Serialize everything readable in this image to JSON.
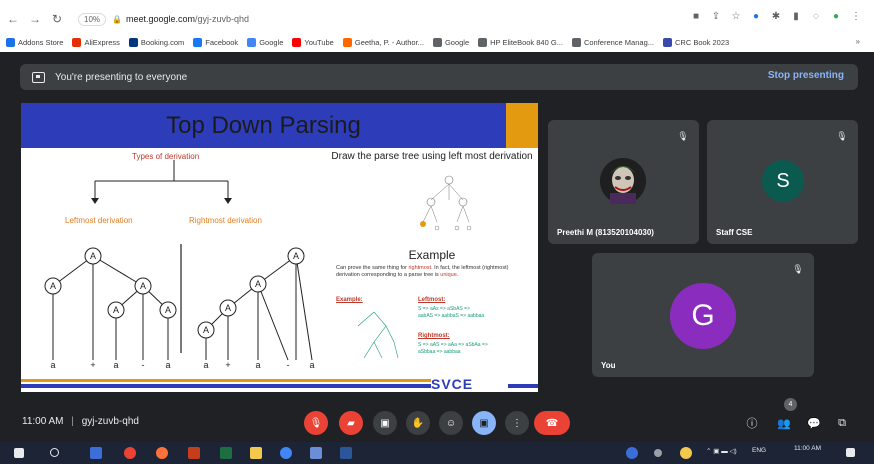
{
  "browser": {
    "zoom": "10%",
    "url_host": "meet.google.com",
    "url_path": "/gyj-zuvb-qhd",
    "bookmarks": [
      {
        "label": "Addons Store",
        "color": "#1a73e8"
      },
      {
        "label": "AliExpress",
        "color": "#e62e04"
      },
      {
        "label": "Booking.com",
        "color": "#003580"
      },
      {
        "label": "Facebook",
        "color": "#1877f2"
      },
      {
        "label": "Google",
        "color": "#4285f4"
      },
      {
        "label": "YouTube",
        "color": "#ff0000"
      },
      {
        "label": "Geetha, P. - Author...",
        "color": "#ff6600"
      },
      {
        "label": "Google",
        "color": "#5f6368"
      },
      {
        "label": "HP EliteBook 840 G...",
        "color": "#5f6368"
      },
      {
        "label": "Conference Manag...",
        "color": "#5f6368"
      },
      {
        "label": "CRC Book 2023",
        "color": "#3949ab"
      }
    ]
  },
  "banner": {
    "text": "You're presenting to everyone",
    "stop_label": "Stop presenting"
  },
  "slide": {
    "title": "Top Down Parsing",
    "types_label": "Types of derivation",
    "leftmost_label": "Leftmost derivation",
    "rightmost_label": "Rightmost derivation",
    "left_leaves": [
      "a",
      "+",
      "a",
      "-",
      "a"
    ],
    "right_leaves": [
      "a",
      "+",
      "a",
      "-",
      "a"
    ],
    "heading": "Draw the parse tree using left most derivation",
    "example_title": "Example",
    "example_text_pre": "Can prove the same thing for ",
    "example_text_red1": "rightmost",
    "example_text_mid": ". In fact, the leftmost (rightmost) derivation corresponding to a parse tree is ",
    "example_text_red2": "unique",
    "example_text_end": ".",
    "example_label": "Example:",
    "leftmost_small": "Leftmost:",
    "leftmost_line1": "S => aAs => aSbAS =>",
    "leftmost_line2": "aabAS => aabbaS => aabbaa",
    "rightmost_small": "Rightmost:",
    "rightmost_line1": "S => aAS => aAa => aSbAa =>",
    "rightmost_line2": "aSbbaa => aabbaa",
    "footer_logo": "SVCE"
  },
  "participants": [
    {
      "name": "Preethi M (813520104030)",
      "initial": "",
      "color": "#2a2a2a"
    },
    {
      "name": "Staff CSE",
      "initial": "S",
      "color": "#0b5a4f"
    },
    {
      "name": "You",
      "initial": "G",
      "color": "#8a2dbf"
    }
  ],
  "bottom": {
    "time": "11:00 AM",
    "separator": "|",
    "code": "gyj-zuvb-qhd",
    "people_count": "4"
  },
  "taskbar": {
    "lang": "ENG",
    "clock": "11:00 AM"
  }
}
